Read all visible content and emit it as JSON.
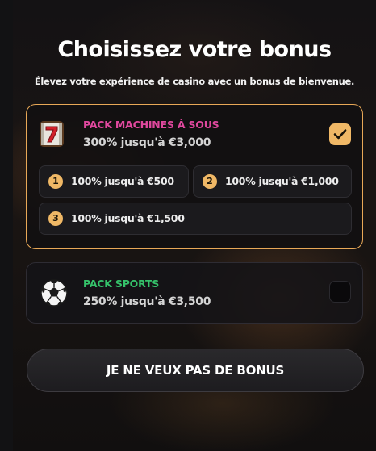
{
  "header": {
    "title": "Choisissez votre bonus",
    "subtitle": "Élevez votre expérience de casino avec un bonus de bienvenue."
  },
  "packs": [
    {
      "name": "PACK MACHINES À SOUS",
      "description": "300% jusqu'à €3,000",
      "icon": "slot-machine-seven-icon",
      "name_color": "#e0489e",
      "selected": true,
      "options": [
        {
          "number": "1",
          "label": "100% jusqu'à €500"
        },
        {
          "number": "2",
          "label": "100% jusqu'à €1,000"
        },
        {
          "number": "3",
          "label": "100% jusqu'à €1,500"
        }
      ]
    },
    {
      "name": "PACK SPORTS",
      "description": "250% jusqu'à €3,500",
      "icon": "soccer-ball-icon",
      "name_color": "#35c26a",
      "selected": false
    }
  ],
  "decline_button": {
    "label": "JE NE VEUX PAS DE BONUS"
  },
  "colors": {
    "accent": "#f0b866",
    "selected_border": "#e8a857"
  }
}
